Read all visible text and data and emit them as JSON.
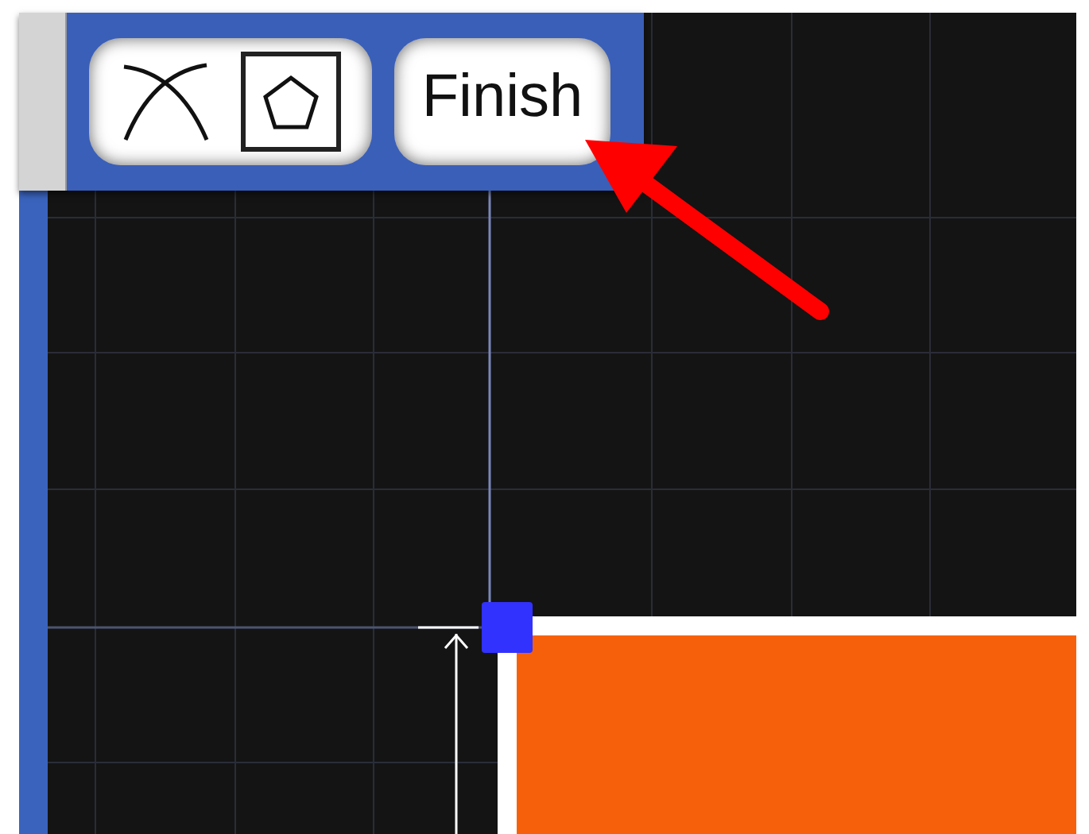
{
  "toolbar": {
    "finish_button": {
      "label": "Finish"
    }
  }
}
